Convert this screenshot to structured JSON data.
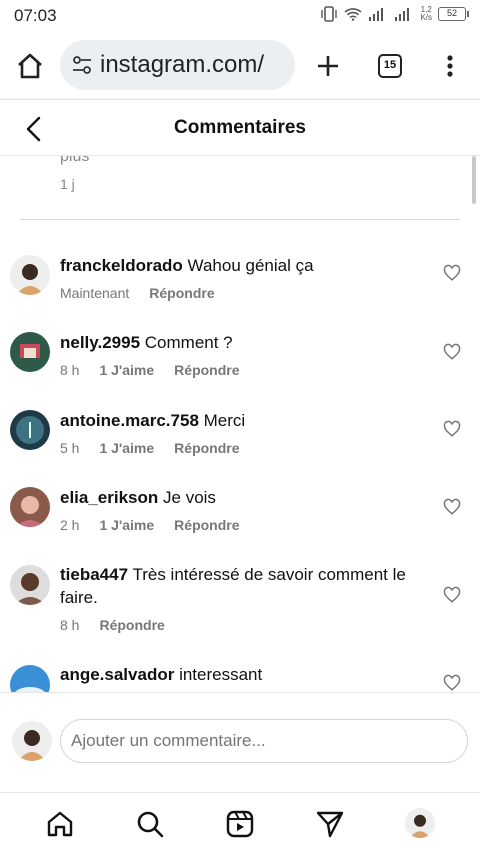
{
  "status_bar": {
    "time": "07:03",
    "net_speed_value": "1,2",
    "net_speed_unit": "K/s",
    "battery": "52"
  },
  "browser": {
    "url": "instagram.com/",
    "tab_count": "15",
    "icons": [
      "home-icon",
      "site-settings-icon",
      "plus-icon",
      "tabs-icon",
      "menu-icon"
    ]
  },
  "header": {
    "title": "Commentaires"
  },
  "previous_comment": {
    "more_text": "plus",
    "time": "1 j"
  },
  "comments": [
    {
      "user": "franckeldorado",
      "text": "Wahou génial ça",
      "time": "Maintenant",
      "likes": "",
      "reply": "Répondre",
      "avatar_color": "#d9a36b"
    },
    {
      "user": "nelly.2995",
      "text": "Comment ?",
      "time": "8 h",
      "likes": "1 J'aime",
      "reply": "Répondre",
      "avatar_color": "#2f5a4a"
    },
    {
      "user": "antoine.marc.758",
      "text": "Merci",
      "time": "5 h",
      "likes": "1 J'aime",
      "reply": "Répondre",
      "avatar_color": "#1f3a46"
    },
    {
      "user": "elia_erikson",
      "text": "Je vois",
      "time": "2 h",
      "likes": "1 J'aime",
      "reply": "Répondre",
      "avatar_color": "#b06c7a"
    },
    {
      "user": "tieba447",
      "text": "Très intéressé de savoir comment le faire.",
      "time": "8 h",
      "likes": "",
      "reply": "Répondre",
      "avatar_color": "#6b4a3a"
    },
    {
      "user": "ange.salvador",
      "text": "interessant",
      "time": "",
      "likes": "",
      "reply": "",
      "avatar_color": "#3a8fd6"
    }
  ],
  "input": {
    "placeholder": "Ajouter un commentaire..."
  },
  "bottom_nav": {
    "items": [
      "home-icon",
      "search-icon",
      "reels-icon",
      "direct-icon",
      "profile-avatar"
    ]
  }
}
